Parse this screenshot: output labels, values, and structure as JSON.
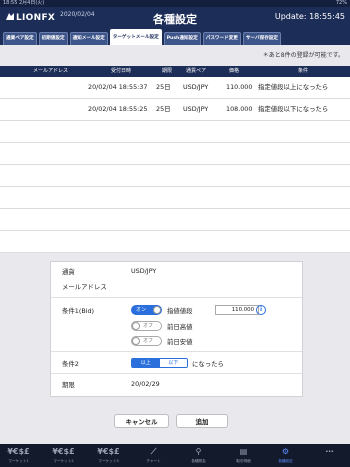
{
  "status_bar": {
    "left": "18:55 2月4日(火)",
    "right": "72%"
  },
  "header": {
    "logo": "LIONFX",
    "date": "2020/02/04",
    "title": "各種設定",
    "update": "Update: 18:55:45"
  },
  "tabs": [
    {
      "label": "通貨ペア設定"
    },
    {
      "label": "初期値設定"
    },
    {
      "label": "通知メール設定"
    },
    {
      "label": "ターゲットメール設定",
      "active": true
    },
    {
      "label": "Push通知設定"
    },
    {
      "label": "パスワード変更"
    },
    {
      "label": "サーバ保存設定"
    }
  ],
  "notice": "＊あと8件の登録が可能です。",
  "table": {
    "columns": [
      "メールアドレス",
      "受付日時",
      "期限",
      "通貨ペア",
      "価格",
      "条件"
    ],
    "rows": [
      {
        "received": "20/02/04 18:55:37",
        "expiry": "25日",
        "pair": "USD/JPY",
        "price": "110.000",
        "condition": "指定値段以上になったら"
      },
      {
        "received": "20/02/04 18:55:25",
        "expiry": "25日",
        "pair": "USD/JPY",
        "price": "108.000",
        "condition": "指定値段以下になったら"
      }
    ]
  },
  "form": {
    "currency_label": "通貨",
    "currency_value": "USD/JPY",
    "email_label": "メールアドレス",
    "condition1_label": "条件1(Bid)",
    "toggle_on": "オン",
    "toggle_off": "オフ",
    "opt_price": "指値値段",
    "price_value": "110.000",
    "opt_high": "前日高値",
    "opt_low": "前日安値",
    "condition2_label": "条件2",
    "seg_above": "以上",
    "seg_below": "以下",
    "condition2_suffix": "になったら",
    "expiry_label": "期限",
    "expiry_value": "20/02/29"
  },
  "buttons": {
    "cancel": "キャンセル",
    "add": "追加"
  },
  "nav": [
    {
      "icon": "¥€$£",
      "label": "マーケット1"
    },
    {
      "icon": "¥€$£",
      "label": "マーケット2"
    },
    {
      "icon": "¥€$£",
      "label": "マーケット3"
    },
    {
      "icon": "⟋",
      "label": "チャート"
    },
    {
      "icon": "⚲",
      "label": "各種照会"
    },
    {
      "icon": "▤",
      "label": "取引明細"
    },
    {
      "icon": "⚙",
      "label": "各種設定",
      "active": true
    },
    {
      "icon": "⋯",
      "label": ""
    }
  ]
}
